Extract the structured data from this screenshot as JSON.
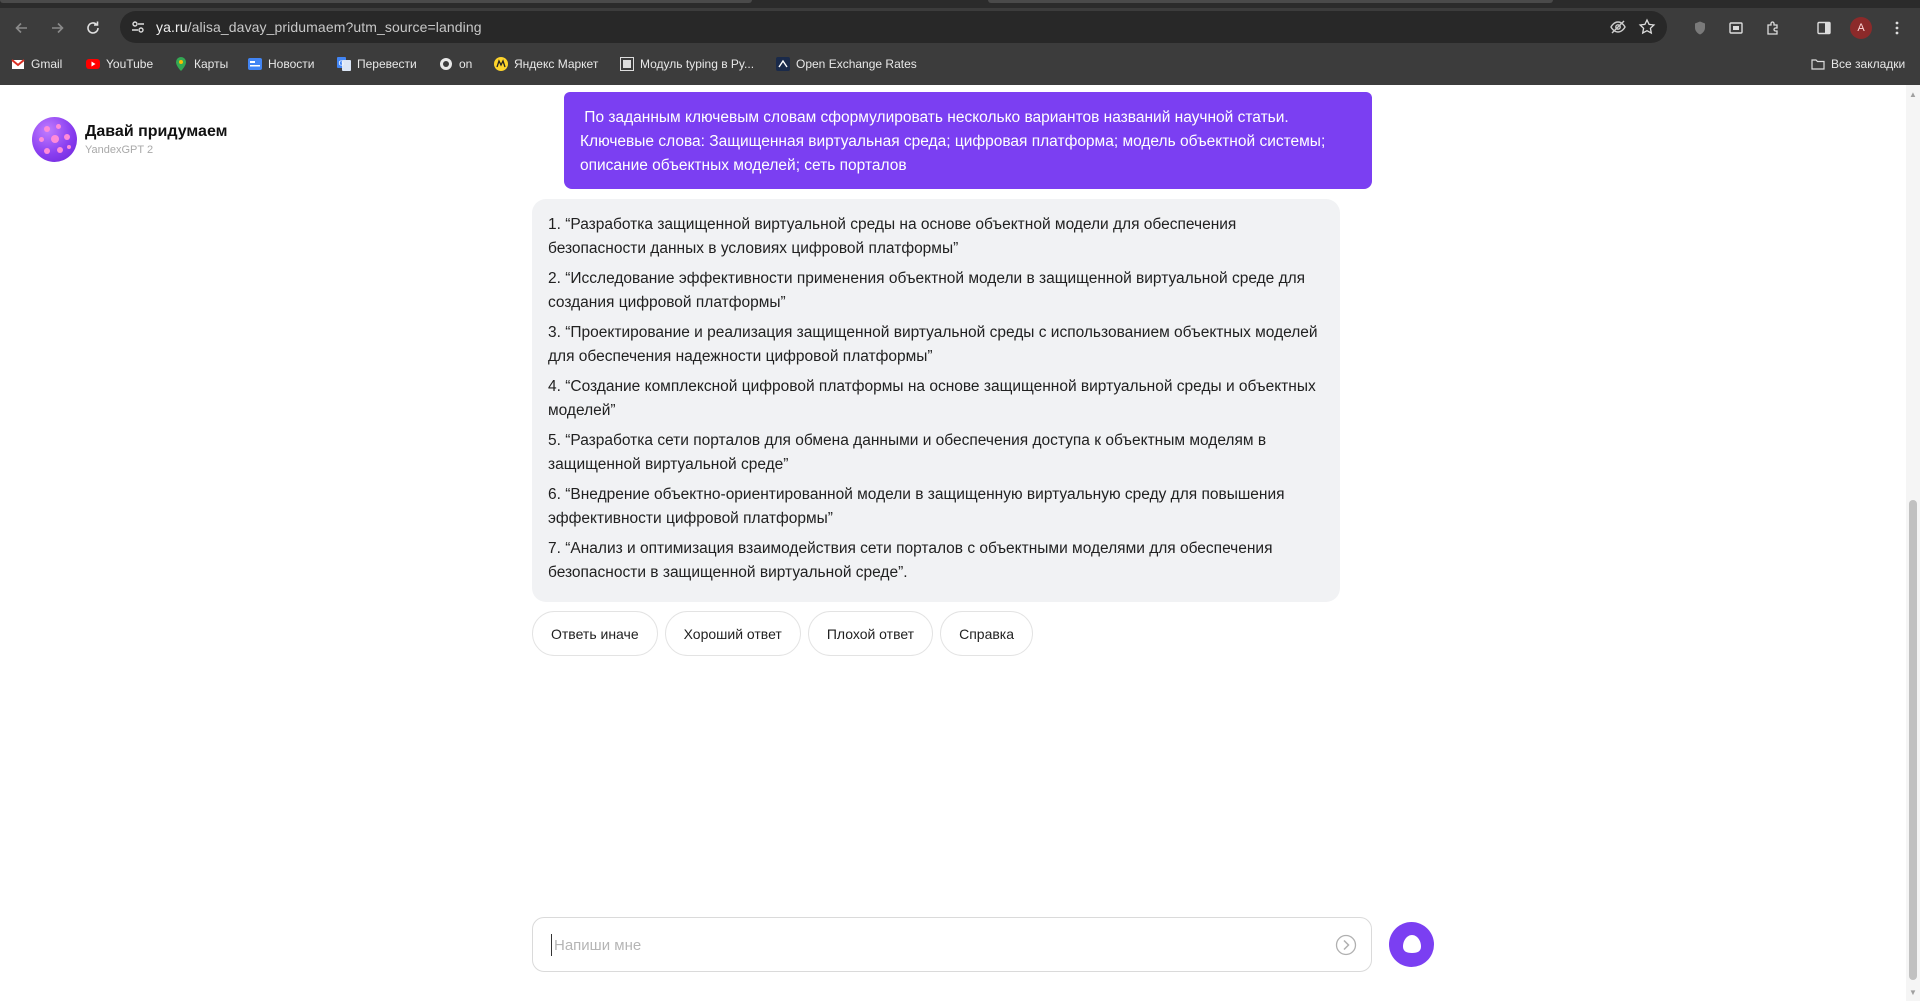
{
  "browser": {
    "url_host": "ya.ru",
    "url_path": "/alisa_davay_pridumaem?utm_source=landing",
    "bookmarks": [
      {
        "label": "Gmail",
        "icon": "gmail-icon"
      },
      {
        "label": "YouTube",
        "icon": "youtube-icon"
      },
      {
        "label": "Карты",
        "icon": "maps-icon"
      },
      {
        "label": "Новости",
        "icon": "news-icon"
      },
      {
        "label": "Перевести",
        "icon": "translate-icon"
      },
      {
        "label": "on",
        "icon": "bookmark-favicon-icon"
      },
      {
        "label": "Яндекс Маркет",
        "icon": "market-icon"
      },
      {
        "label": "Модуль typing в Py...",
        "icon": "bookmark-favicon-icon"
      },
      {
        "label": "Open Exchange Rates",
        "icon": "bookmark-favicon-icon"
      }
    ],
    "all_bookmarks": "Все закладки",
    "profile_initial": "A",
    "colors": {
      "chrome_bg": "#3c3c3c",
      "omnibox_bg": "#282828"
    }
  },
  "assistant": {
    "name": "Давай придумаем",
    "model": "YandexGPT 2"
  },
  "chat": {
    "user_message_lines": [
      " По заданным ключевым словам сформулировать несколько вариантов названий научной статьи.",
      "Ключевые слова: Защищенная виртуальная среда; цифровая платформа; модель объектной системы;",
      "описание объектных моделей; сеть порталов"
    ],
    "answer_items": [
      "1. “Разработка защищенной виртуальной среды на основе объектной модели для обеспечения безопасности данных в условиях цифровой платформы”",
      "2. “Исследование эффективности применения объектной модели в защищенной виртуальной среде для создания цифровой платформы”",
      "3. “Проектирование и реализация защищенной виртуальной среды с использованием объектных моделей для обеспечения надежности цифровой платформы”",
      "4. “Создание комплексной цифровой платформы на основе защищенной виртуальной среды и объектных моделей”",
      "5. “Разработка сети порталов для обмена данными и обеспечения доступа к объектным моделям в защищенной виртуальной среде”",
      "6. “Внедрение объектно-ориентированной модели в защищенную виртуальную среду для повышения эффективности цифровой платформы”",
      "7. “Анализ и оптимизация взаимодействия сети порталов с объектными моделями для обеспечения безопасности в защищенной виртуальной среде”."
    ],
    "actions": [
      "Ответь иначе",
      "Хороший ответ",
      "Плохой ответ",
      "Справка"
    ],
    "input_placeholder": "Напиши мне",
    "colors": {
      "accent": "#7b3ff2",
      "answer_bg": "#f1f2f4"
    }
  }
}
